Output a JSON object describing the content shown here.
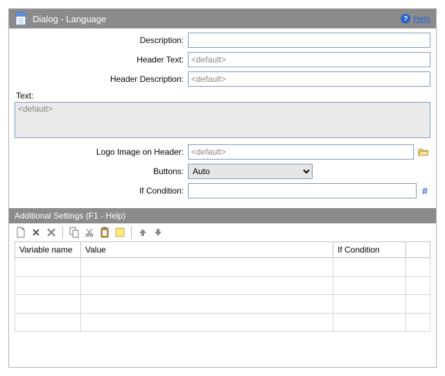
{
  "header": {
    "title": "Dialog - Language",
    "help_label": "Help"
  },
  "form": {
    "description_label": "Description:",
    "description_value": "",
    "header_text_label": "Header Text:",
    "header_text_value": "<default>",
    "header_description_label": "Header Description:",
    "header_description_value": "<default>",
    "text_label": "Text:",
    "text_value": "<default>",
    "logo_label": "Logo Image on Header:",
    "logo_value": "<default>",
    "buttons_label": "Buttons:",
    "buttons_value": "Auto",
    "if_condition_label": "If Condition:",
    "if_condition_value": ""
  },
  "additional": {
    "title": "Additional Settings (F1 - Help)",
    "columns": {
      "variable": "Variable name",
      "value": "Value",
      "condition": "If Condition"
    }
  }
}
